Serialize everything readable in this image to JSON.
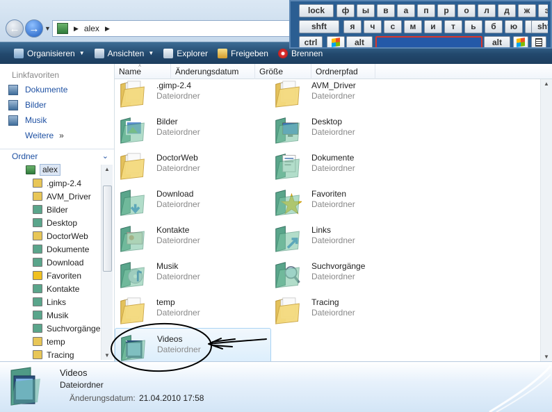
{
  "address": {
    "folder": "alex"
  },
  "toolbar": {
    "organise": "Organisieren",
    "views": "Ansichten",
    "explorer": "Explorer",
    "share": "Freigeben",
    "burn": "Brennen"
  },
  "columns": [
    "Name",
    "Änderungsdatum",
    "Größe",
    "Ordnerpfad"
  ],
  "nav": {
    "favorites_title": "Linkfavoriten",
    "favorites": [
      "Dokumente",
      "Bilder",
      "Musik"
    ],
    "more": "Weitere",
    "more_arrows": "»",
    "folders_title": "Ordner"
  },
  "tree": {
    "root": "alex",
    "items": [
      ".gimp-2.4",
      "AVM_Driver",
      "Bilder",
      "Desktop",
      "DoctorWeb",
      "Dokumente",
      "Download",
      "Favoriten",
      "Kontakte",
      "Links",
      "Musik",
      "Suchvorgänge",
      "temp",
      "Tracing"
    ]
  },
  "folders": [
    {
      "name": ".gimp-2.4",
      "type": "Dateiordner"
    },
    {
      "name": "AVM_Driver",
      "type": "Dateiordner"
    },
    {
      "name": "Bilder",
      "type": "Dateiordner"
    },
    {
      "name": "Desktop",
      "type": "Dateiordner"
    },
    {
      "name": "DoctorWeb",
      "type": "Dateiordner"
    },
    {
      "name": "Dokumente",
      "type": "Dateiordner"
    },
    {
      "name": "Download",
      "type": "Dateiordner"
    },
    {
      "name": "Favoriten",
      "type": "Dateiordner"
    },
    {
      "name": "Kontakte",
      "type": "Dateiordner"
    },
    {
      "name": "Links",
      "type": "Dateiordner"
    },
    {
      "name": "Musik",
      "type": "Dateiordner"
    },
    {
      "name": "Suchvorgänge",
      "type": "Dateiordner"
    },
    {
      "name": "temp",
      "type": "Dateiordner"
    },
    {
      "name": "Tracing",
      "type": "Dateiordner"
    },
    {
      "name": "Videos",
      "type": "Dateiordner"
    }
  ],
  "details": {
    "name": "Videos",
    "type": "Dateiordner",
    "date_label": "Änderungsdatum:",
    "date": "21.04.2010 17:58"
  },
  "keyboard": {
    "row1": [
      "lock",
      "ф",
      "ы",
      "в",
      "а",
      "п",
      "р",
      "о",
      "л",
      "д",
      "ж",
      "э",
      "e"
    ],
    "row2": [
      "shft",
      "я",
      "ч",
      "с",
      "м",
      "и",
      "т",
      "ь",
      "б",
      "ю",
      ".",
      "shft"
    ],
    "row3_left": [
      "ctrl",
      "alt"
    ],
    "row3_right": [
      "alt"
    ]
  },
  "colors": {
    "toolbar": "#22486d",
    "link": "#1e50a2",
    "selection": "#dceefc",
    "keyboard_bg": "#2b5e92",
    "space_key": "#2459a8",
    "space_border": "#d9352b"
  }
}
